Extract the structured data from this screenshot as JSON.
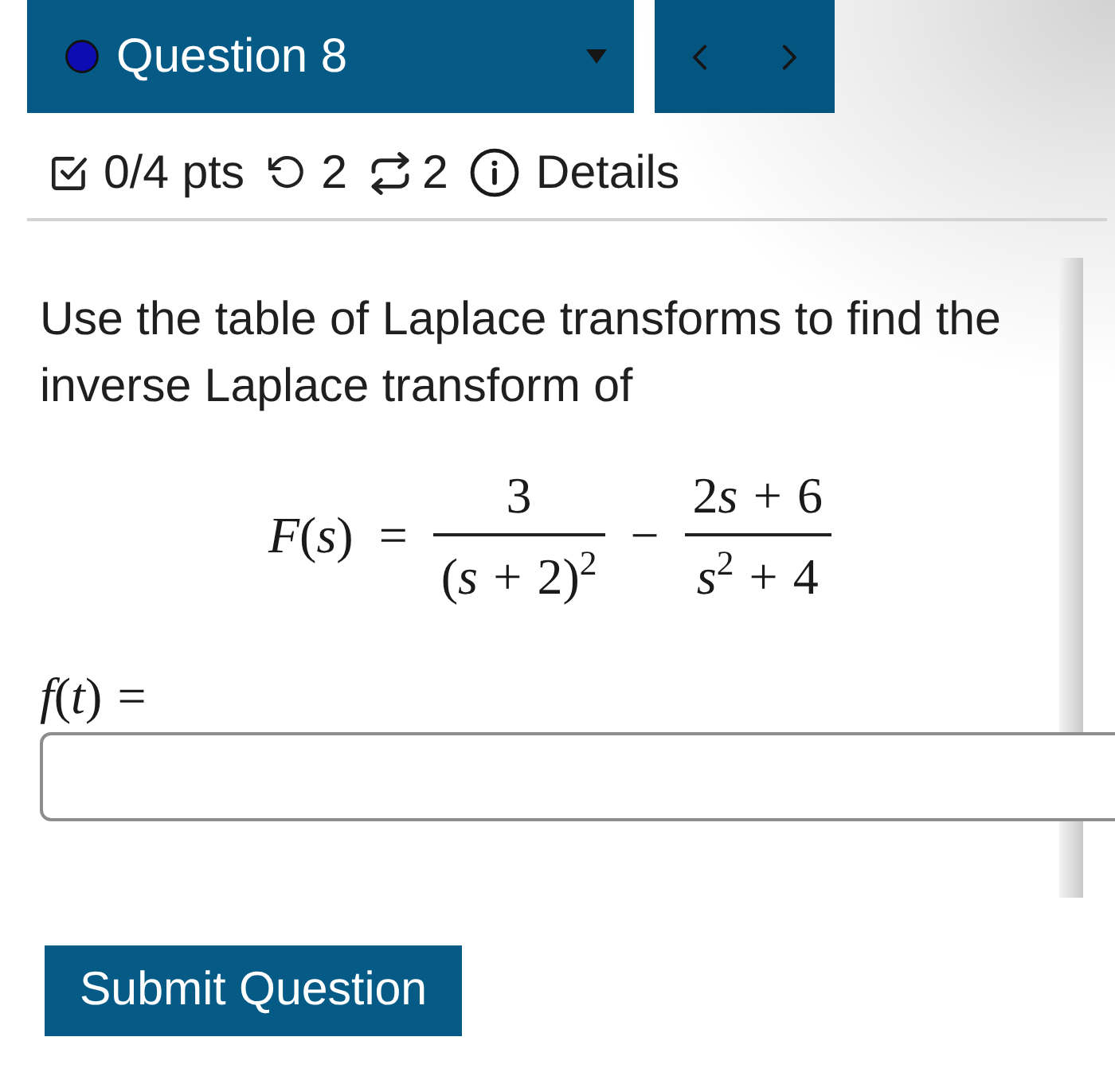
{
  "header": {
    "title": "Question 8"
  },
  "meta": {
    "points": "0/4 pts",
    "undo_count": "2",
    "repeat_count": "2",
    "details": "Details"
  },
  "question": {
    "prompt": "Use the table of Laplace transforms to find the inverse Laplace transform of",
    "equation": {
      "lhs": "F(s)",
      "sign": "=",
      "terms": [
        {
          "numerator": "3",
          "denominator": "(s + 2)$^{2}$"
        },
        {
          "operator": "−",
          "numerator": "2s + 6",
          "denominator": "s$^{2}$ + 4"
        }
      ]
    },
    "answer": {
      "label": "f(t) ="
    }
  },
  "submit": {
    "label": "Submit Question"
  }
}
